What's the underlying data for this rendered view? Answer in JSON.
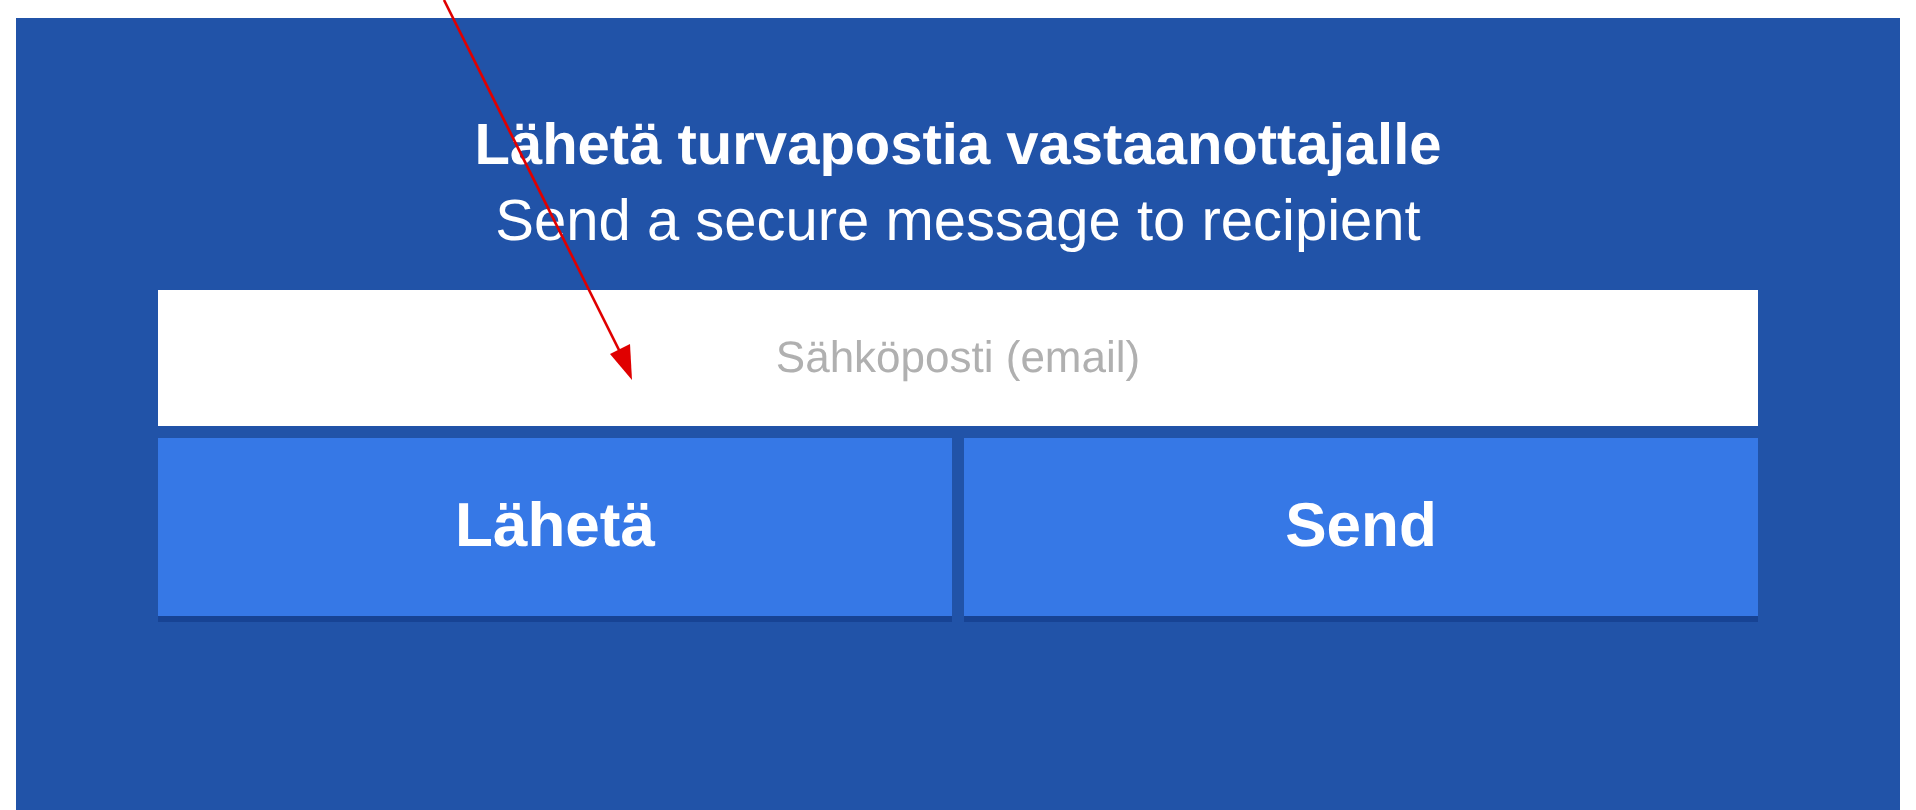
{
  "title": "Lähetä turvapostia vastaanottajalle",
  "subtitle": "Send a secure message to recipient",
  "email_field": {
    "placeholder": "Sähköposti (email)"
  },
  "buttons": [
    {
      "label": "Lähetä"
    },
    {
      "label": "Send"
    }
  ]
}
